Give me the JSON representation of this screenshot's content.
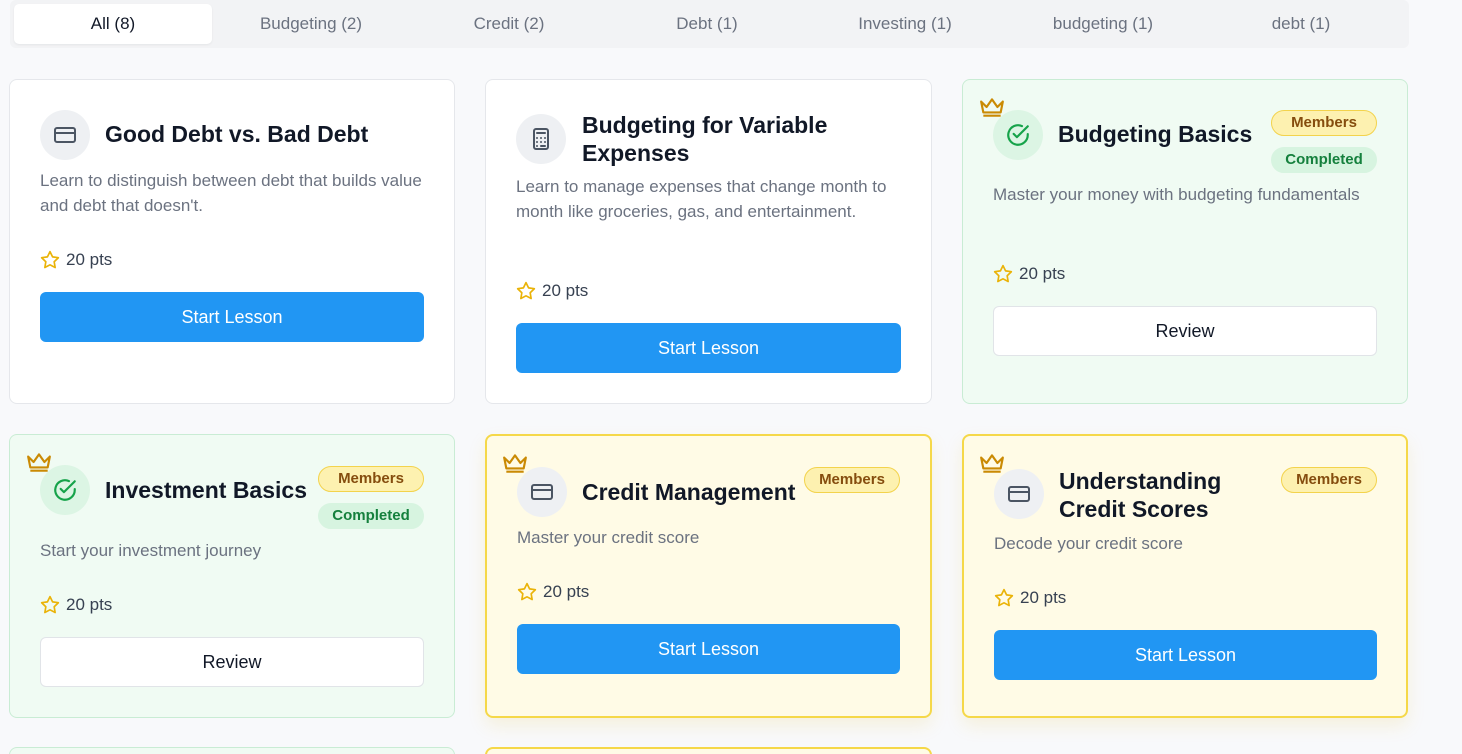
{
  "tabs": [
    {
      "label": "All (8)",
      "active": true
    },
    {
      "label": "Budgeting (2)"
    },
    {
      "label": "Credit (2)"
    },
    {
      "label": "Debt (1)"
    },
    {
      "label": "Investing (1)"
    },
    {
      "label": "budgeting (1)"
    },
    {
      "label": "debt (1)"
    }
  ],
  "cards": [
    {
      "title": "Good Debt vs. Bad Debt",
      "description": "Learn to distinguish between debt that builds value and debt that doesn't.",
      "points": "20 pts",
      "icon": "credit-card-icon",
      "action": "Start Lesson",
      "status": "default"
    },
    {
      "title": "Budgeting for Variable Expenses",
      "description": "Learn to manage expenses that change month to month like groceries, gas, and entertainment.",
      "points": "20 pts",
      "icon": "calculator-icon",
      "action": "Start Lesson",
      "status": "default"
    },
    {
      "title": "Budgeting Basics",
      "description": "Master your money with budgeting fundamentals",
      "points": "20 pts",
      "icon": "check-circle-icon",
      "action": "Review",
      "status": "completed",
      "badges": [
        "Members",
        "Completed"
      ]
    },
    {
      "title": "Investment Basics",
      "description": "Start your investment journey",
      "points": "20 pts",
      "icon": "check-circle-icon",
      "action": "Review",
      "status": "completed",
      "badges": [
        "Members",
        "Completed"
      ]
    },
    {
      "title": "Credit Management",
      "description": "Master your credit score",
      "points": "20 pts",
      "icon": "credit-card-icon",
      "action": "Start Lesson",
      "status": "members",
      "badges": [
        "Members"
      ]
    },
    {
      "title": "Understanding Credit Scores",
      "description": "Decode your credit score",
      "points": "20 pts",
      "icon": "credit-card-icon",
      "action": "Start Lesson",
      "status": "members",
      "badges": [
        "Members"
      ]
    }
  ],
  "colors": {
    "primary": "#2196f3",
    "members_border": "#f5d849",
    "completed_bg": "#f0fbf3",
    "star": "#eab308",
    "crown": "#ca8a04"
  }
}
